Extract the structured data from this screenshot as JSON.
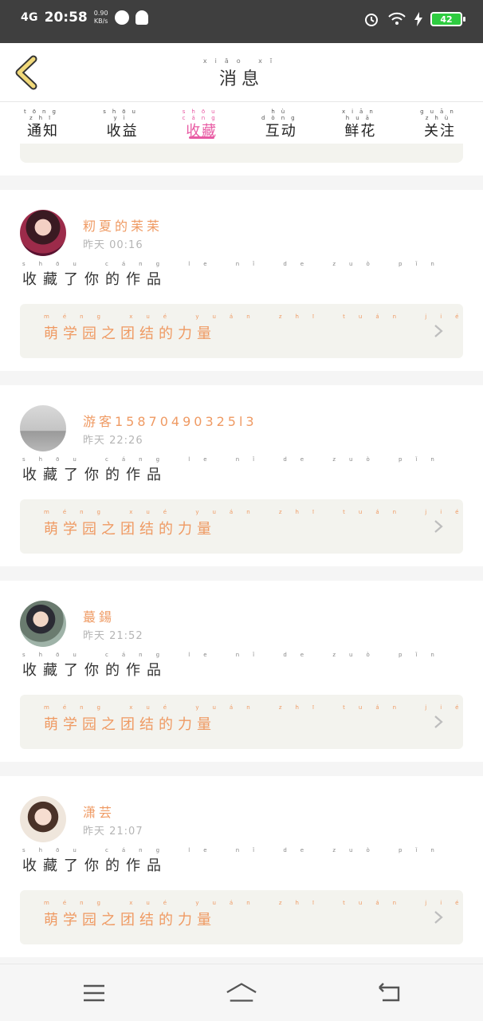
{
  "statusbar": {
    "signal": "4G",
    "time": "20:58",
    "speed_value": "0.90",
    "speed_unit": "KB/s",
    "battery": "42"
  },
  "header": {
    "title_pinyin": "xiāo xī",
    "title": "消息"
  },
  "tabs": [
    {
      "pinyin": "tōng zhī",
      "label": "通知",
      "active": false
    },
    {
      "pinyin": "shōu yì",
      "label": "收益",
      "active": false
    },
    {
      "pinyin": "shōu cáng",
      "label": "收藏",
      "active": true
    },
    {
      "pinyin": "hù dòng",
      "label": "互动",
      "active": false
    },
    {
      "pinyin": "xiān huā",
      "label": "鲜花",
      "active": false
    },
    {
      "pinyin": "guān zhù",
      "label": "关注",
      "active": false
    }
  ],
  "items": [
    {
      "user": "籾夏的苿苿",
      "time": "昨天 00:16",
      "action_pinyin": "shōu cáng le nǐ de zuò pǐn",
      "action": "收藏了你的作品",
      "work_pinyin": "méng xué yuán zhī tuán jié de lì liàng",
      "work": "萌学园之团结的力量"
    },
    {
      "user": "游客15870490325l3",
      "time": "昨天 22:26",
      "action_pinyin": "shōu cáng le nǐ de zuò pǐn",
      "action": "收藏了你的作品",
      "work_pinyin": "méng xué yuán zhī tuán jié de lì liàng",
      "work": "萌学园之团结的力量"
    },
    {
      "user": "蕞鍚",
      "time": "昨天 21:52",
      "action_pinyin": "shōu cáng le nǐ de zuò pǐn",
      "action": "收藏了你的作品",
      "work_pinyin": "méng xué yuán zhī tuán jié de lì liàng",
      "work": "萌学园之团结的力量"
    },
    {
      "user": "潇芸",
      "time": "昨天 21:07",
      "action_pinyin": "shōu cáng le nǐ de zuò pǐn",
      "action": "收藏了你的作品",
      "work_pinyin": "méng xué yuán zhī tuán jié de lì liàng",
      "work": "萌学园之团结的力量"
    }
  ],
  "nav": {
    "menu": "menu-icon",
    "home": "home-icon",
    "back": "back-icon"
  },
  "colors": {
    "accent_pink": "#e85aa3",
    "accent_orange": "#ef9a63",
    "back_arrow": "#f1d97a"
  }
}
